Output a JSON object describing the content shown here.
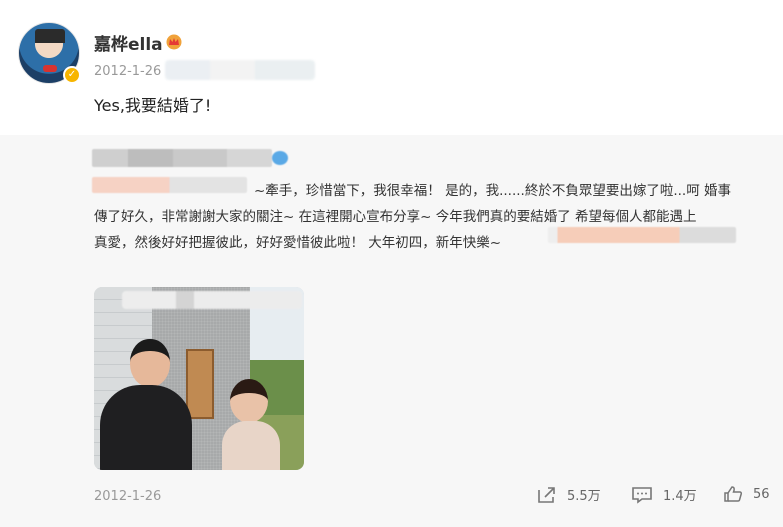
{
  "author": {
    "name": "嘉桦ella",
    "verified_icon": "verified-badge-icon",
    "member_icon": "crown-icon"
  },
  "post": {
    "date": "2012-1-26",
    "text": "Yes,我要結婚了!"
  },
  "repost": {
    "lines": [
      "~牽手，珍惜當下，我很幸福！ 是的，我......終於不負眾望要出嫁了啦...呵 婚事",
      "傳了好久，非常謝謝大家的關注~ 在這裡開心宣布分享~ 今年我們真的要結婚了 希望每個人都能遇上",
      "真愛，然後好好把握彼此，好好愛惜彼此啦！ 大年初四，新年快樂~"
    ],
    "date": "2012-1-26"
  },
  "actions": {
    "share_count": "5.5万",
    "comment_count": "1.4万",
    "like_count": "56"
  },
  "colors": {
    "accent": "#f7b500",
    "repost_bg": "#f7f7f7",
    "muted_text": "#999999"
  }
}
